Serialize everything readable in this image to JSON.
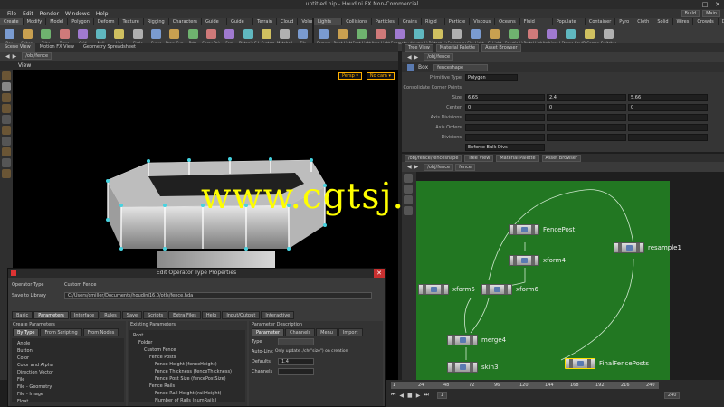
{
  "window": {
    "title": "untitled.hip - Houdini FX Non-Commercial",
    "min": "–",
    "max": "□",
    "close": "✕"
  },
  "menu": {
    "items": [
      "File",
      "Edit",
      "Render",
      "Windows",
      "Help"
    ],
    "right_desktop": "Build",
    "right_release": "Main"
  },
  "shelf_left": {
    "tabs": [
      "Create",
      "Modify",
      "Model",
      "Polygon",
      "Deform",
      "Texture",
      "Rigging",
      "Characters",
      "Guide Process",
      "Guide Brushes",
      "Terrain FX",
      "Cloud FX",
      "Volume"
    ],
    "tools": [
      "Box",
      "Sphere",
      "Tube",
      "Torus",
      "Grid",
      "Null",
      "Line",
      "Circle",
      "Curve",
      "Draw Curve",
      "Path",
      "Spray Paint",
      "Font",
      "Platonic Solids",
      "L-System",
      "Metaball",
      "File"
    ]
  },
  "shelf_right": {
    "tabs": [
      "Lights and Cameras",
      "Collisions",
      "Particles",
      "Grains",
      "Rigid Bodies",
      "Particle Fluids",
      "Viscous Fluids",
      "Oceans",
      "Fluid Containers",
      "Populate Containers",
      "Container Tools",
      "Pyro FX",
      "Cloth",
      "Solid",
      "Wires",
      "Crowds",
      "Drive Simulation"
    ],
    "tools": [
      "Camera",
      "Point Light",
      "Spot Light",
      "Area Light",
      "Geometry Light",
      "Volume Light",
      "Distant Light",
      "Environment Light",
      "Sky Light",
      "GI Light",
      "Caustic Light",
      "Portal Light",
      "Ambient Light",
      "Stereo Camera",
      "VR Camera",
      "Switcher"
    ]
  },
  "scene_view": {
    "tabs": [
      "Scene View",
      "Motion FX View",
      "Geometry Spreadsheet"
    ],
    "path": "/obj/fence",
    "label": "View",
    "persp": "Persp ▾",
    "cam": "No cam ▾"
  },
  "watermark": "www.cgtsj.com",
  "params": {
    "tabs": [
      "Tree View",
      "Material Palette",
      "Asset Browser"
    ],
    "path": "/obj/fence",
    "node_type": "Box",
    "node_name": "fenceshape",
    "rows": [
      {
        "label": "Primitive Type",
        "fields": [
          "Polygon"
        ]
      },
      {
        "label": "Consolidate Corner Points",
        "fields": []
      },
      {
        "label": "Size",
        "fields": [
          "6.65",
          "2.4",
          "5.66"
        ]
      },
      {
        "label": "Center",
        "fields": [
          "0",
          "0",
          "0"
        ]
      },
      {
        "label": "Axis Divisions",
        "fields": [
          "",
          "",
          ""
        ]
      },
      {
        "label": "Axis Orders",
        "fields": [
          "",
          "",
          ""
        ]
      },
      {
        "label": "Divisions",
        "fields": [
          "",
          "",
          ""
        ]
      },
      {
        "label": "",
        "fields": [
          "Enforce Bulk Divs"
        ]
      }
    ]
  },
  "network": {
    "tabs": [
      "/obj/fence/fenceshape",
      "Tree View",
      "Material Palette",
      "Asset Browser"
    ],
    "path": "/obj/fence",
    "node_label": "fence",
    "nodes": [
      {
        "name": "FencePost",
        "selected": false
      },
      {
        "name": "xform4",
        "selected": false
      },
      {
        "name": "resample1",
        "selected": false
      },
      {
        "name": "xform5",
        "selected": false
      },
      {
        "name": "xform6",
        "selected": false
      },
      {
        "name": "merge4",
        "selected": false
      },
      {
        "name": "skin3",
        "selected": false
      },
      {
        "name": "FinalFencePosts",
        "selected": true
      }
    ]
  },
  "dialog": {
    "title": "Edit Operator Type Properties",
    "operator_type_label": "Operator Type",
    "operator_type_value": "Custom Fence",
    "library_label": "Save to Library",
    "library_value": "C:/Users/cmiller/Documents/houdini16.0/otls/fence.hda",
    "tabs": [
      "Basic",
      "Parameters",
      "Interface",
      "Rules",
      "Save",
      "Scripts",
      "Extra Files",
      "Help",
      "Input/Output",
      "Interactive"
    ],
    "create_params_label": "Create Parameters",
    "existing_params_label": "Existing Parameters",
    "param_desc_label": "Parameter Description",
    "subtabs_left": [
      "By Type",
      "From Scripting",
      "From Nodes"
    ],
    "subtabs_right": [
      "Parameter",
      "Channels",
      "Menu",
      "Import"
    ],
    "type_list": [
      "Angle",
      "Button",
      "Color",
      "Color and Alpha",
      "Direction Vector",
      "File",
      "File - Geometry",
      "File - Image",
      "Float",
      "Float Vector 2"
    ],
    "tree": [
      "Root",
      "Folder",
      "Custom Fence",
      "Fence Posts",
      "Fence Height (fenceHeight)",
      "Fence Thickness (fenceThickness)",
      "Fence Post Size (fencePostSize)",
      "Fence Rails",
      "Fence Rail Height (railHeight)",
      "Number of Rails (numRails)"
    ],
    "default_label": "Defaults",
    "default_value": "1.4",
    "type_label": "Type",
    "channels_label": "Channels",
    "expression_label": "Auto-Link",
    "expression_value": "Only update ./ch(\"size\") on creation"
  },
  "timeline": {
    "ticks": [
      "1",
      "24",
      "48",
      "72",
      "96",
      "120",
      "144",
      "168",
      "192",
      "216",
      "240"
    ],
    "frame": "1",
    "end": "240"
  }
}
